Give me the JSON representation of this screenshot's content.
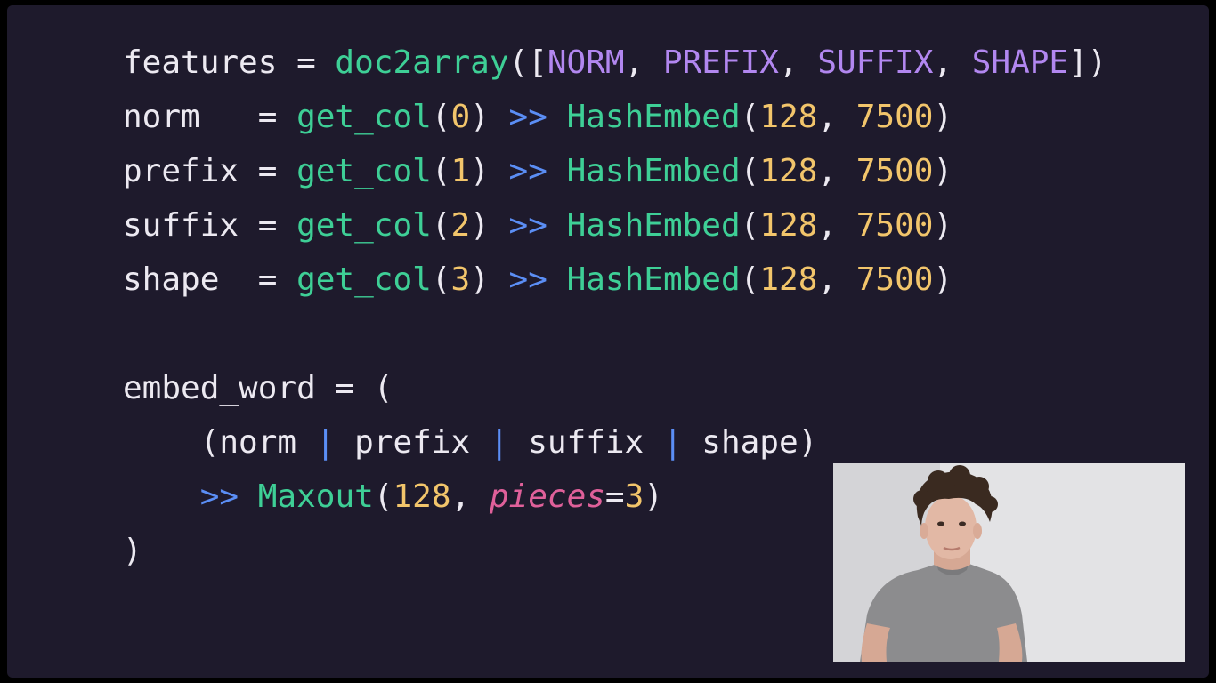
{
  "code_lines": [
    [
      {
        "text": "features = ",
        "role": "var"
      },
      {
        "text": "doc2array",
        "role": "fn"
      },
      {
        "text": "([",
        "role": "punc"
      },
      {
        "text": "NORM",
        "role": "const"
      },
      {
        "text": ", ",
        "role": "punc"
      },
      {
        "text": "PREFIX",
        "role": "const"
      },
      {
        "text": ", ",
        "role": "punc"
      },
      {
        "text": "SUFFIX",
        "role": "const"
      },
      {
        "text": ", ",
        "role": "punc"
      },
      {
        "text": "SHAPE",
        "role": "const"
      },
      {
        "text": "])",
        "role": "punc"
      }
    ],
    [
      {
        "text": "norm   = ",
        "role": "var"
      },
      {
        "text": "get_col",
        "role": "fn"
      },
      {
        "text": "(",
        "role": "punc"
      },
      {
        "text": "0",
        "role": "num"
      },
      {
        "text": ") ",
        "role": "punc"
      },
      {
        "text": ">>",
        "role": "op"
      },
      {
        "text": " ",
        "role": "punc"
      },
      {
        "text": "HashEmbed",
        "role": "fn"
      },
      {
        "text": "(",
        "role": "punc"
      },
      {
        "text": "128",
        "role": "num"
      },
      {
        "text": ", ",
        "role": "punc"
      },
      {
        "text": "7500",
        "role": "num"
      },
      {
        "text": ")",
        "role": "punc"
      }
    ],
    [
      {
        "text": "prefix = ",
        "role": "var"
      },
      {
        "text": "get_col",
        "role": "fn"
      },
      {
        "text": "(",
        "role": "punc"
      },
      {
        "text": "1",
        "role": "num"
      },
      {
        "text": ") ",
        "role": "punc"
      },
      {
        "text": ">>",
        "role": "op"
      },
      {
        "text": " ",
        "role": "punc"
      },
      {
        "text": "HashEmbed",
        "role": "fn"
      },
      {
        "text": "(",
        "role": "punc"
      },
      {
        "text": "128",
        "role": "num"
      },
      {
        "text": ", ",
        "role": "punc"
      },
      {
        "text": "7500",
        "role": "num"
      },
      {
        "text": ")",
        "role": "punc"
      }
    ],
    [
      {
        "text": "suffix = ",
        "role": "var"
      },
      {
        "text": "get_col",
        "role": "fn"
      },
      {
        "text": "(",
        "role": "punc"
      },
      {
        "text": "2",
        "role": "num"
      },
      {
        "text": ") ",
        "role": "punc"
      },
      {
        "text": ">>",
        "role": "op"
      },
      {
        "text": " ",
        "role": "punc"
      },
      {
        "text": "HashEmbed",
        "role": "fn"
      },
      {
        "text": "(",
        "role": "punc"
      },
      {
        "text": "128",
        "role": "num"
      },
      {
        "text": ", ",
        "role": "punc"
      },
      {
        "text": "7500",
        "role": "num"
      },
      {
        "text": ")",
        "role": "punc"
      }
    ],
    [
      {
        "text": "shape  = ",
        "role": "var"
      },
      {
        "text": "get_col",
        "role": "fn"
      },
      {
        "text": "(",
        "role": "punc"
      },
      {
        "text": "3",
        "role": "num"
      },
      {
        "text": ") ",
        "role": "punc"
      },
      {
        "text": ">>",
        "role": "op"
      },
      {
        "text": " ",
        "role": "punc"
      },
      {
        "text": "HashEmbed",
        "role": "fn"
      },
      {
        "text": "(",
        "role": "punc"
      },
      {
        "text": "128",
        "role": "num"
      },
      {
        "text": ", ",
        "role": "punc"
      },
      {
        "text": "7500",
        "role": "num"
      },
      {
        "text": ")",
        "role": "punc"
      }
    ],
    [],
    [
      {
        "text": "embed_word = (",
        "role": "var"
      }
    ],
    [
      {
        "text": "    (norm ",
        "role": "var"
      },
      {
        "text": "|",
        "role": "op"
      },
      {
        "text": " prefix ",
        "role": "var"
      },
      {
        "text": "|",
        "role": "op"
      },
      {
        "text": " suffix ",
        "role": "var"
      },
      {
        "text": "|",
        "role": "op"
      },
      {
        "text": " shape)",
        "role": "var"
      }
    ],
    [
      {
        "text": "    ",
        "role": "punc"
      },
      {
        "text": ">>",
        "role": "op"
      },
      {
        "text": " ",
        "role": "punc"
      },
      {
        "text": "Maxout",
        "role": "fn"
      },
      {
        "text": "(",
        "role": "punc"
      },
      {
        "text": "128",
        "role": "num"
      },
      {
        "text": ", ",
        "role": "punc"
      },
      {
        "text": "pieces",
        "role": "kw"
      },
      {
        "text": "=",
        "role": "punc"
      },
      {
        "text": "3",
        "role": "num"
      },
      {
        "text": ")",
        "role": "punc"
      }
    ],
    [
      {
        "text": ")",
        "role": "var"
      }
    ]
  ],
  "colors": {
    "background": "#1e1a2c",
    "text": "#ece9f1",
    "function": "#3ecf96",
    "number": "#f2c56b",
    "constant": "#b287f0",
    "operator": "#5b8ef5",
    "keyword_arg": "#e0609a"
  },
  "webcam": {
    "description_icon": "presenter-video-icon"
  }
}
